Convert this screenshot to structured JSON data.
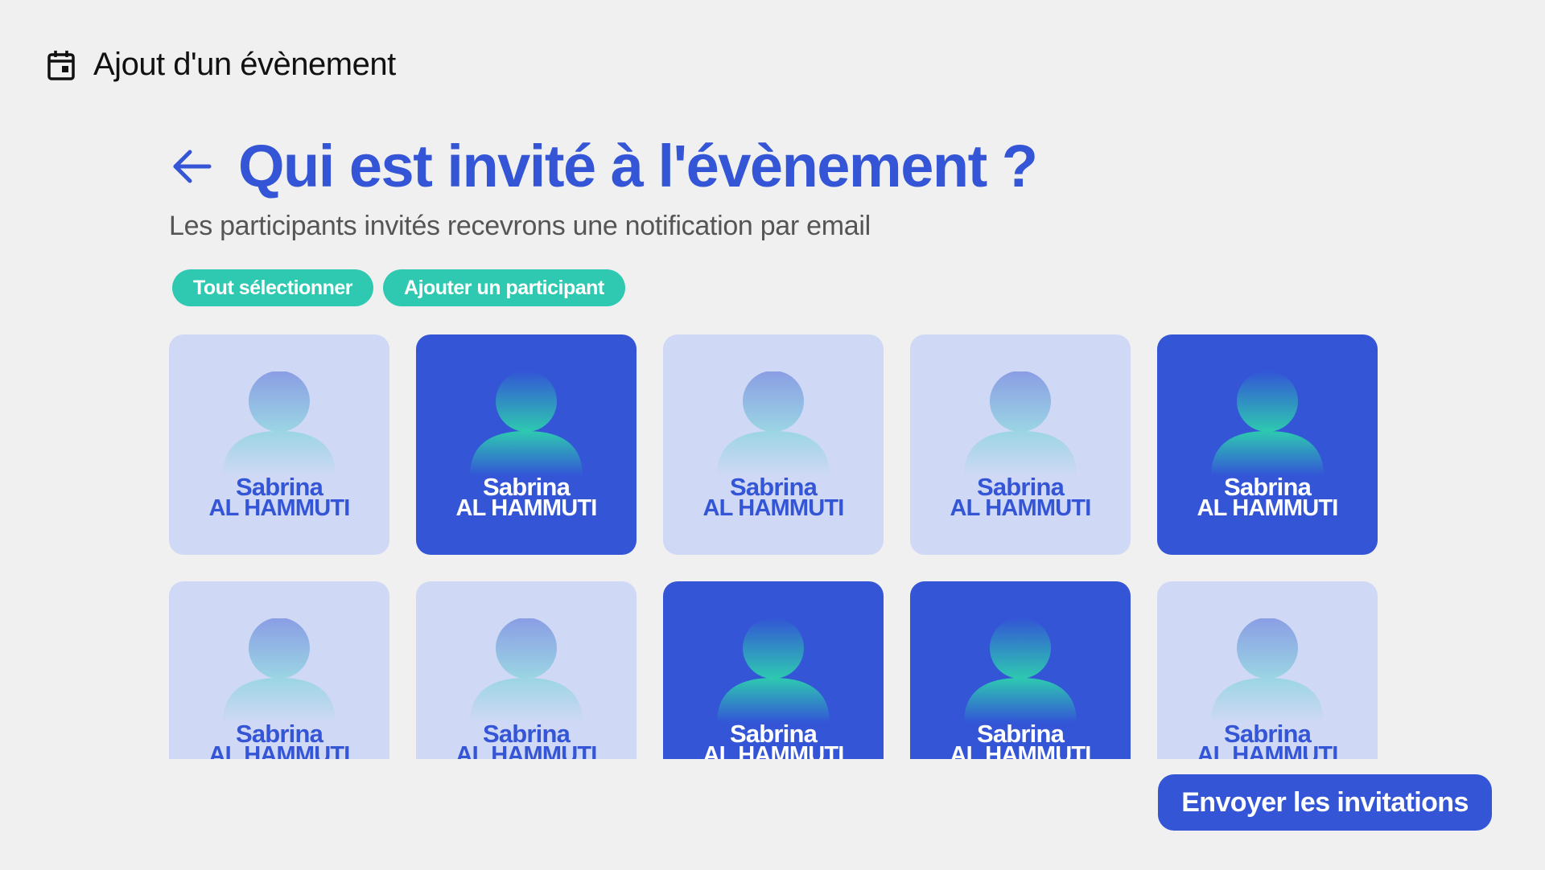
{
  "header": {
    "icon": "calendar-icon",
    "title": "Ajout d'un évènement"
  },
  "main": {
    "back_icon": "arrow-left-icon",
    "title": "Qui est invité à l'évènement ?",
    "subtitle": "Les participants invités recevrons une notification par email"
  },
  "actions": {
    "select_all": "Tout sélectionner",
    "add_participant": "Ajouter un participant"
  },
  "participants": [
    {
      "first": "Sabrina",
      "last": "AL HAMMUTI",
      "selected": false
    },
    {
      "first": "Sabrina",
      "last": "AL HAMMUTI",
      "selected": true
    },
    {
      "first": "Sabrina",
      "last": "AL HAMMUTI",
      "selected": false
    },
    {
      "first": "Sabrina",
      "last": "AL HAMMUTI",
      "selected": false
    },
    {
      "first": "Sabrina",
      "last": "AL HAMMUTI",
      "selected": true
    },
    {
      "first": "Sabrina",
      "last": "AL HAMMUTI",
      "selected": false
    },
    {
      "first": "Sabrina",
      "last": "AL HAMMUTI",
      "selected": false
    },
    {
      "first": "Sabrina",
      "last": "AL HAMMUTI",
      "selected": true
    },
    {
      "first": "Sabrina",
      "last": "AL HAMMUTI",
      "selected": true
    },
    {
      "first": "Sabrina",
      "last": "AL HAMMUTI",
      "selected": false
    }
  ],
  "footer": {
    "send_label": "Envoyer les invitations"
  },
  "colors": {
    "primary": "#3355d6",
    "accent": "#2ec9b0",
    "card_unselected": "#cfd8f5",
    "background": "#f0f0f0"
  }
}
